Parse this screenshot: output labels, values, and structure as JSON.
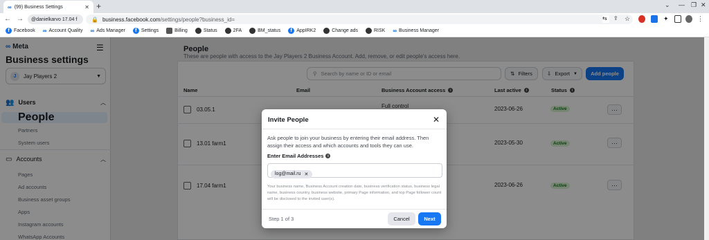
{
  "browser": {
    "tab_title": "(99) Business Settings",
    "profile": "@danielkarvo 17.04 f",
    "url_host": "business.facebook.com",
    "url_path": "/settings/people?business_id=",
    "bookmarks": [
      "Facebook",
      "Account Quality",
      "Ads Manager",
      "Settings",
      "Billing",
      "Status",
      "2FA",
      "BM_status",
      "AppIRK2",
      "Change ads",
      "RISK",
      "Business Manager"
    ]
  },
  "sidebar": {
    "brand": "Meta",
    "title": "Business settings",
    "account_initial": "J",
    "account_name": "Jay Players 2",
    "sections": {
      "users": "Users",
      "accounts": "Accounts"
    },
    "user_items": [
      "People",
      "Partners",
      "System users"
    ],
    "account_items": [
      "Pages",
      "Ad accounts",
      "Business asset groups",
      "Apps",
      "Instagram accounts",
      "WhatsApp Accounts"
    ]
  },
  "main": {
    "title": "People",
    "subtitle": "These are people with access to the Jay Players 2 Business Account. Add, remove, or edit people's access here.",
    "search_placeholder": "Search by name or ID or email",
    "filters": "Filters",
    "export": "Export",
    "add_people": "Add people",
    "columns": [
      "Name",
      "Email",
      "Business Account access",
      "Last active",
      "Status"
    ],
    "rows": [
      {
        "name": "03.05.1",
        "access": "Full control",
        "last_active": "2023-06-26",
        "status": "Active"
      },
      {
        "name": "13.01 farm1",
        "access": "",
        "last_active": "2023-05-30",
        "status": "Active"
      },
      {
        "name": "17.04 farm1",
        "access": "",
        "last_active": "2023-06-26",
        "status": "Active"
      }
    ]
  },
  "modal": {
    "title": "Invite People",
    "body": "Ask people to join your business by entering their email address. Then assign their access and which accounts and tools they can use.",
    "field_label": "Enter Email Addresses",
    "chip": "log@mail.ru",
    "note": "Your business name, Business Account creation date, business verification status, business legal name, business country, business website, primary Page information, and top Page follower count will be disclosed to the invited user(s).",
    "step": "Step 1 of 3",
    "cancel": "Cancel",
    "next": "Next"
  },
  "colors": {
    "accent": "#1877f2",
    "active_badge": "#d8f5d2"
  }
}
